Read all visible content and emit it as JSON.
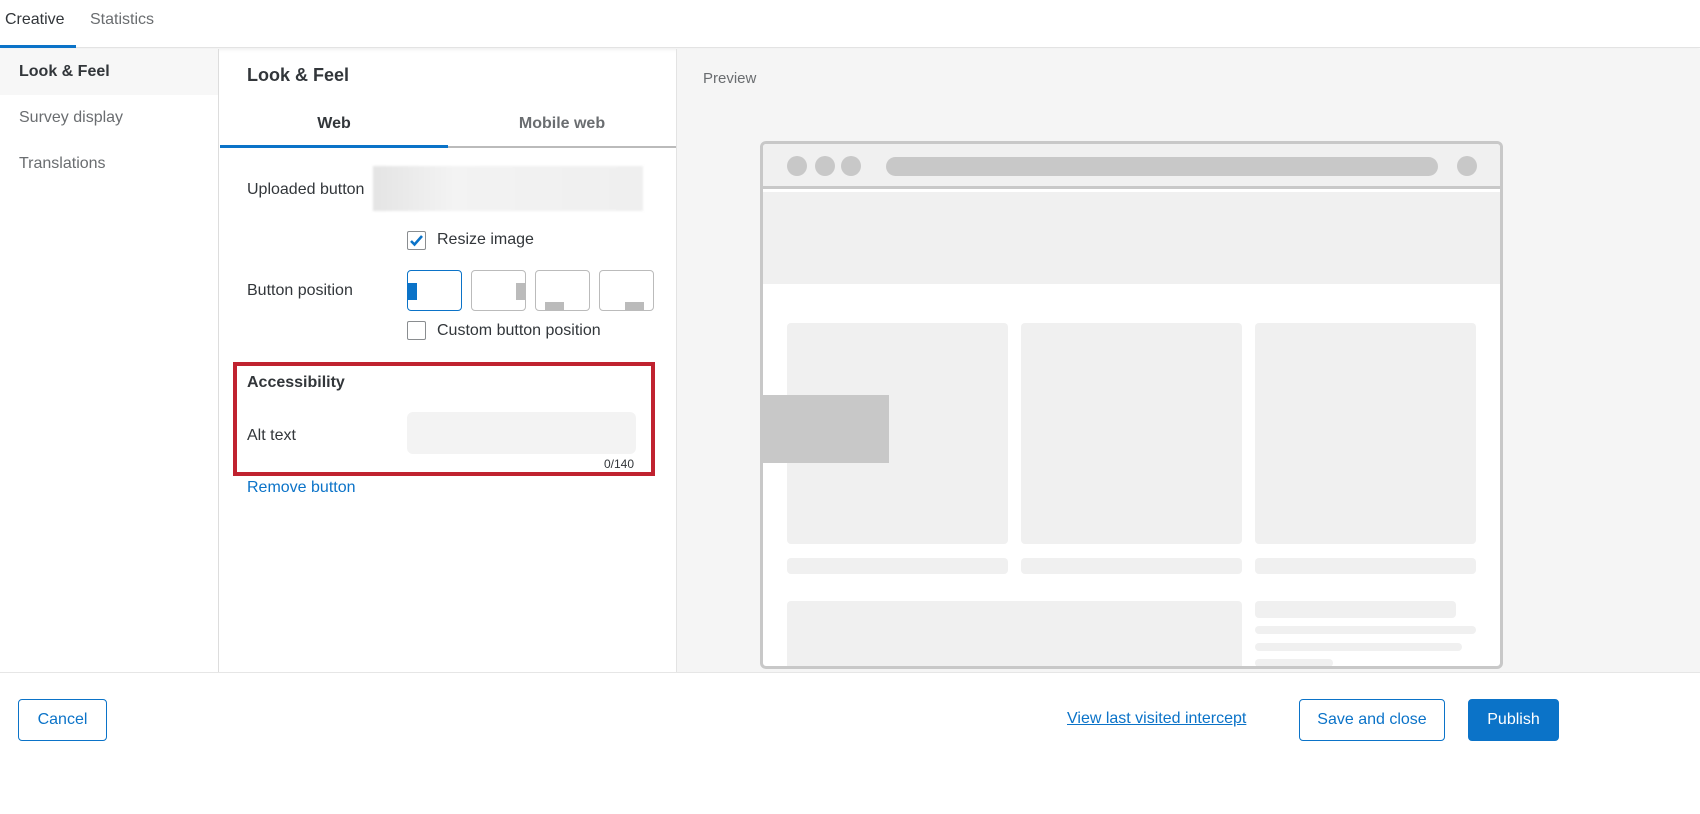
{
  "top_tabs": [
    {
      "label": "Creative"
    },
    {
      "label": "Statistics"
    }
  ],
  "sidebar": {
    "items": [
      {
        "label": "Look & Feel"
      },
      {
        "label": "Survey display"
      },
      {
        "label": "Translations"
      }
    ]
  },
  "panel": {
    "title": "Look & Feel",
    "tabs": [
      {
        "label": "Web"
      },
      {
        "label": "Mobile web"
      }
    ],
    "uploaded_button_label": "Uploaded button",
    "resize_image_label": "Resize image",
    "resize_image_checked": true,
    "button_position_label": "Button position",
    "custom_position_label": "Custom button position",
    "accessibility_heading": "Accessibility",
    "alt_text_label": "Alt text",
    "alt_text_value": "",
    "alt_text_counter": "0/140",
    "remove_button_label": "Remove button"
  },
  "preview": {
    "label": "Preview"
  },
  "footer": {
    "cancel": "Cancel",
    "view_last": "View last visited intercept",
    "save_close": "Save and close",
    "publish": "Publish"
  },
  "colors": {
    "accent": "#0b73c8",
    "highlight": "#c0222f"
  }
}
